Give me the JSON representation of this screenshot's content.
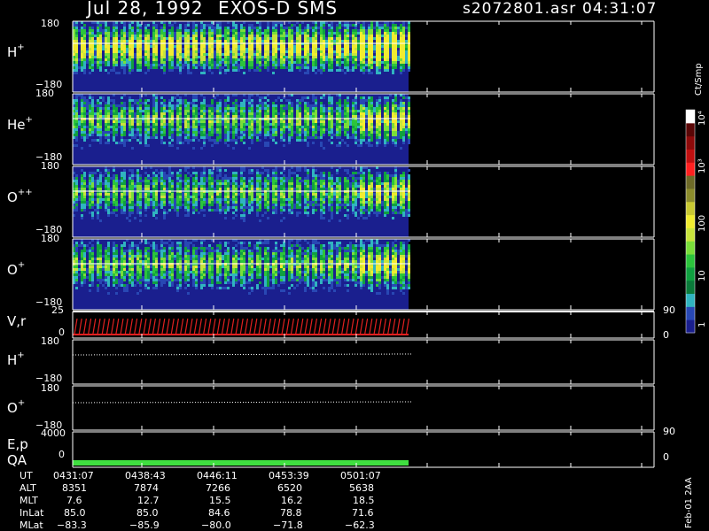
{
  "header": {
    "date": "Jul 28, 1992",
    "instrument": "EXOS-D SMS",
    "file": "s2072801.asr",
    "time": "04:31:07"
  },
  "panels": [
    {
      "label": "H",
      "sup": "+",
      "ymax": "180",
      "ymin": "−180"
    },
    {
      "label": "He",
      "sup": "+",
      "ymax": "180",
      "ymin": "−180"
    },
    {
      "label": "O",
      "sup": "++",
      "ymax": "180",
      "ymin": "−180"
    },
    {
      "label": "O",
      "sup": "+",
      "ymax": "180",
      "ymin": "−180"
    }
  ],
  "vr_panel": {
    "label": "V,r",
    "ymax": "25",
    "ymin": "0",
    "right_max": "90",
    "right_min": "0"
  },
  "h_line_panel": {
    "label": "H",
    "sup": "+",
    "ymax": "180",
    "ymin": "−180"
  },
  "o_line_panel": {
    "label": "O",
    "sup": "+",
    "ymax": "180",
    "ymin": "−180"
  },
  "ep_panel": {
    "label1": "E,p",
    "label2": "QA",
    "ymax": "4000",
    "ymin": "0",
    "right_max": "90",
    "right_min": "0"
  },
  "colorbar": {
    "unit": "Ct/Smp",
    "labels": [
      "1",
      "10",
      "100",
      "10³",
      "10⁴"
    ],
    "colors": [
      "#1a1f8e",
      "#2848b4",
      "#30b4c0",
      "#0a7a3a",
      "#10a040",
      "#2cc43c",
      "#7ade3a",
      "#c8e43c",
      "#f0ec30",
      "#c8c832",
      "#8c8c2c",
      "#6e6a28",
      "#ff2020",
      "#c01010",
      "#8e0a0a",
      "#5a0606",
      "#ffffff"
    ]
  },
  "ephemeris": {
    "keys": [
      "UT",
      "ALT",
      "MLT",
      "InLat",
      "MLat"
    ],
    "columns": [
      {
        "UT": "0431:07",
        "ALT": "8351",
        "MLT": "7.6",
        "InLat": "85.0",
        "MLat": "−83.3"
      },
      {
        "UT": "0438:43",
        "ALT": "7874",
        "MLT": "12.7",
        "InLat": "85.0",
        "MLat": "−85.9"
      },
      {
        "UT": "0446:11",
        "ALT": "7266",
        "MLT": "15.5",
        "InLat": "84.6",
        "MLat": "−80.0"
      },
      {
        "UT": "0453:39",
        "ALT": "6520",
        "MLT": "16.2",
        "InLat": "78.8",
        "MLat": "−71.8"
      },
      {
        "UT": "0501:07",
        "ALT": "5638",
        "MLT": "18.5",
        "InLat": "71.6",
        "MLat": "−62.3"
      }
    ]
  },
  "footer_note": "Feb-01 2AA",
  "chart_data": {
    "type": "heatmap",
    "title": "Jul 28, 1992   EXOS-D SMS",
    "x_tick_labels": [
      "0431:07",
      "0438:43",
      "0446:11",
      "0453:39",
      "0501:07"
    ],
    "ylim": [
      -180,
      180
    ],
    "color_scale": "log",
    "color_range": [
      1,
      10000
    ],
    "data_coverage_fraction": 0.5,
    "series": [
      {
        "name": "H+",
        "panel": "heatmap"
      },
      {
        "name": "He+",
        "panel": "heatmap"
      },
      {
        "name": "O++",
        "panel": "heatmap"
      },
      {
        "name": "O+",
        "panel": "heatmap"
      }
    ]
  }
}
